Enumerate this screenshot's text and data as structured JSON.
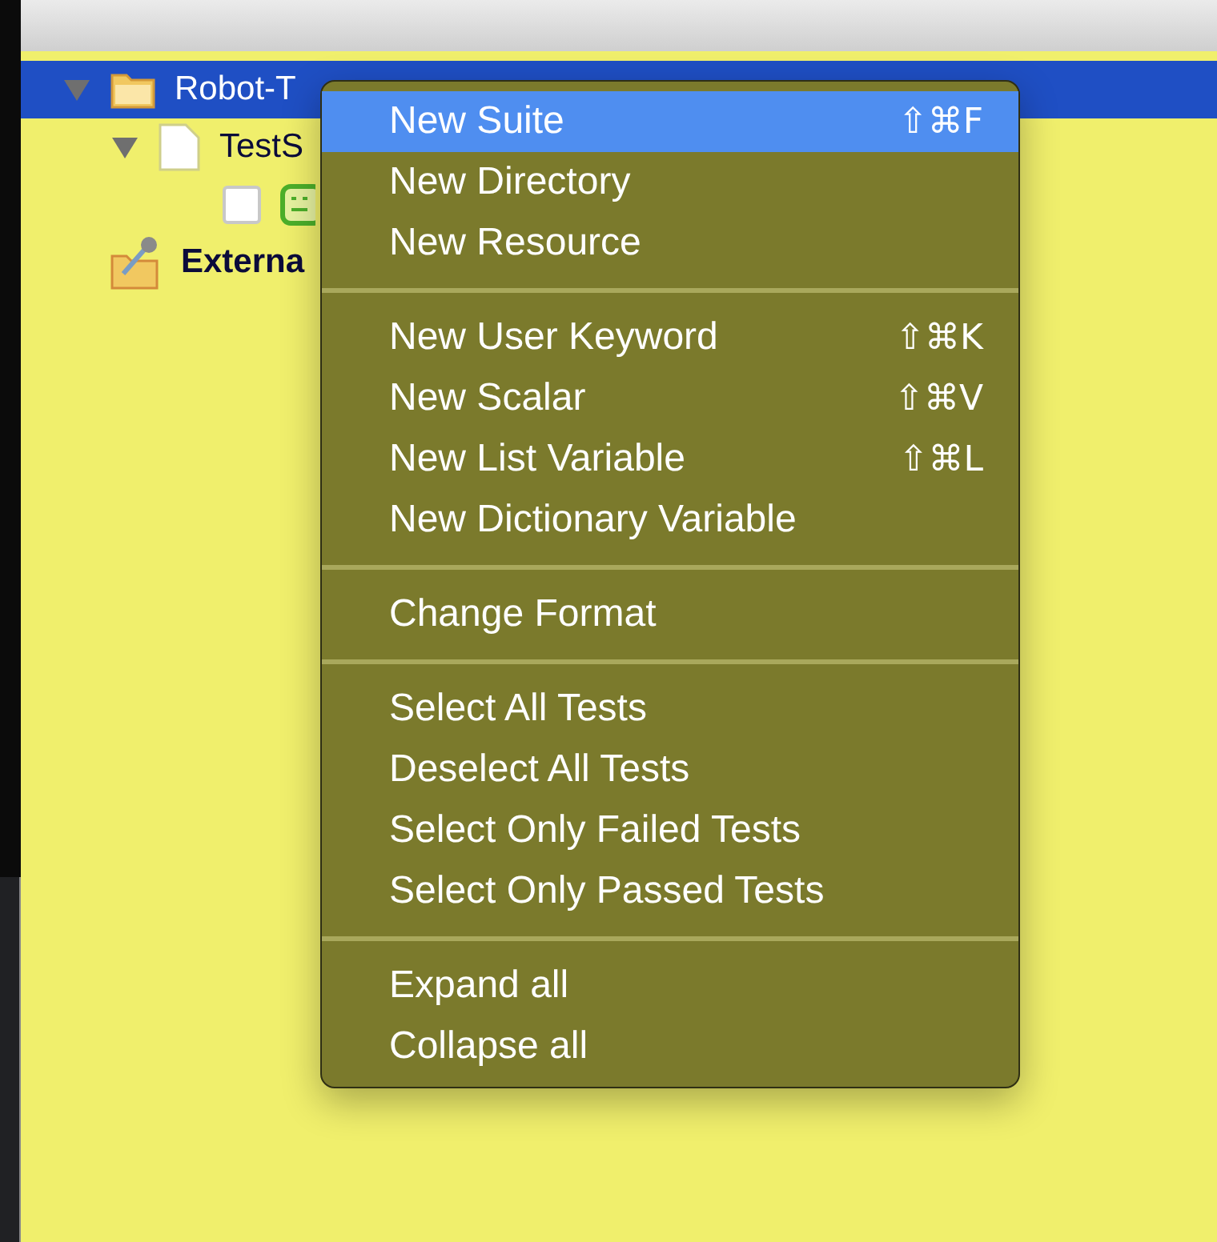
{
  "tree": [
    {
      "label": "Robot-T",
      "kind": "folder",
      "expanded": true,
      "selected": true,
      "children": [
        {
          "label": "TestS",
          "kind": "document",
          "expanded": true,
          "selected": false,
          "children": [
            {
              "kind": "robot",
              "checked": false,
              "selected": false
            }
          ]
        }
      ]
    },
    {
      "label": "Externa",
      "kind": "external",
      "selected": false
    }
  ],
  "context_menu": {
    "sections": [
      [
        {
          "label": "New Suite",
          "shortcut": "⇧⌘F",
          "selected": true
        },
        {
          "label": "New Directory",
          "selected": false
        },
        {
          "label": "New Resource",
          "selected": false
        }
      ],
      [
        {
          "label": "New User Keyword",
          "shortcut": "⇧⌘K",
          "selected": false
        },
        {
          "label": "New Scalar",
          "shortcut": "⇧⌘V",
          "selected": false
        },
        {
          "label": "New List Variable",
          "shortcut": "⇧⌘L",
          "selected": false
        },
        {
          "label": "New Dictionary Variable",
          "selected": false
        }
      ],
      [
        {
          "label": "Change Format",
          "selected": false
        }
      ],
      [
        {
          "label": "Select All Tests",
          "selected": false
        },
        {
          "label": "Deselect All Tests",
          "selected": false
        },
        {
          "label": "Select Only Failed Tests",
          "selected": false
        },
        {
          "label": "Select Only Passed Tests",
          "selected": false
        }
      ],
      [
        {
          "label": "Expand all",
          "selected": false
        },
        {
          "label": "Collapse all",
          "selected": false
        }
      ]
    ]
  }
}
